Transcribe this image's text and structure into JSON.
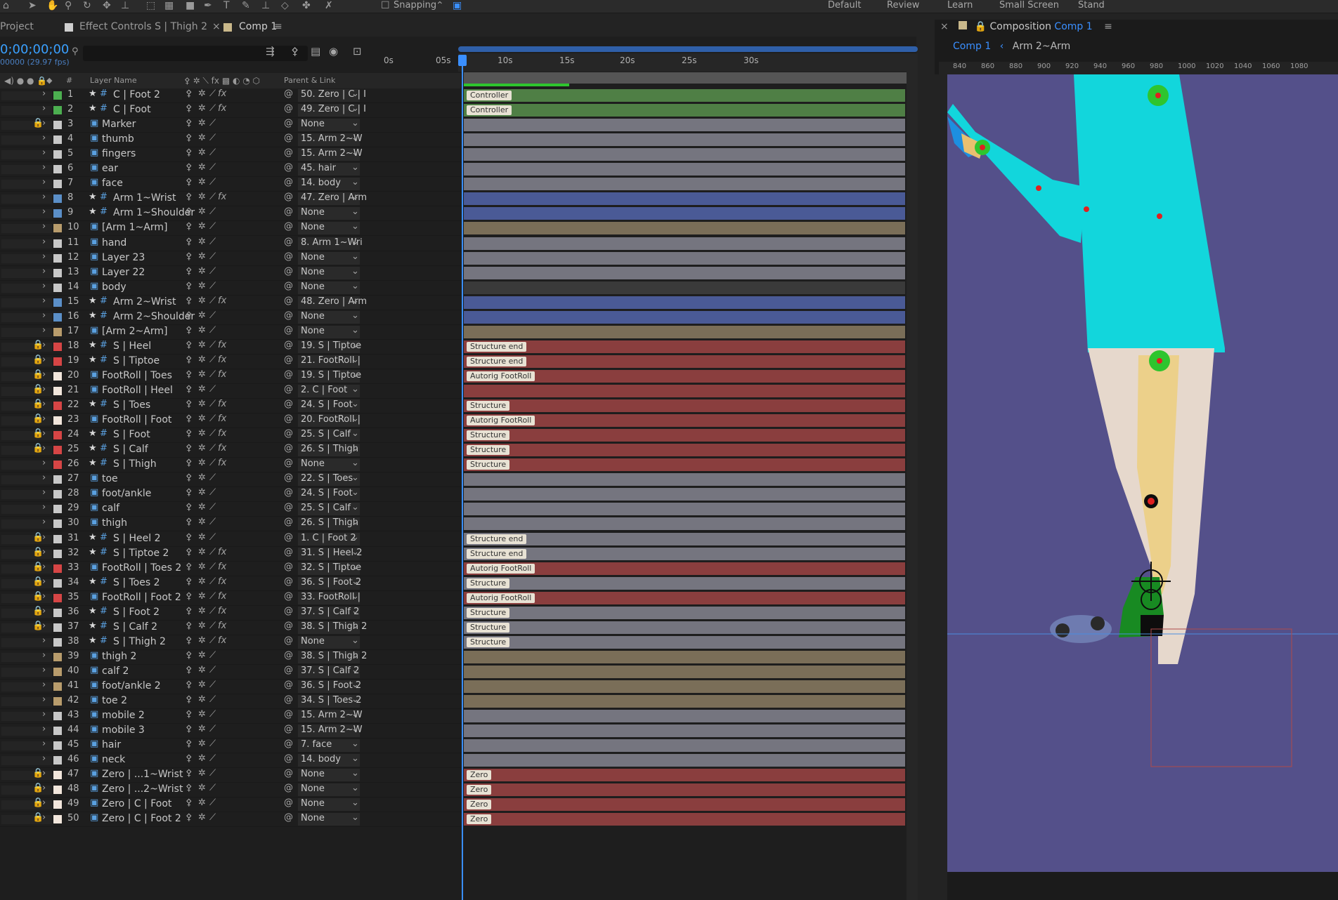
{
  "toolbar": {
    "snapping_label": "Snapping",
    "workspaces": [
      "Default",
      "Review",
      "Learn",
      "Small Screen",
      "Stand"
    ]
  },
  "tabs": {
    "project": "Project",
    "effect_controls": "Effect Controls S | Thigh 2",
    "comp": "Comp 1",
    "composition_prefix": "Composition",
    "composition_name": "Comp 1"
  },
  "timeline": {
    "timecode": "0;00;00;00",
    "fps": "00000 (29.97 fps)",
    "headers": {
      "hash": "#",
      "layer_name": "Layer Name",
      "parent": "Parent & Link"
    },
    "ticks": [
      "0s",
      "05s",
      "10s",
      "15s",
      "20s",
      "25s",
      "30s"
    ],
    "layers": [
      {
        "num": "1",
        "name": "C | Foot 2",
        "color": "#4caf50",
        "star": true,
        "locked": false,
        "fx": true,
        "parent": "50. Zero | C | I",
        "bar": "#4f7f45",
        "label": "Controller"
      },
      {
        "num": "2",
        "name": "C | Foot",
        "color": "#4caf50",
        "star": true,
        "locked": false,
        "fx": true,
        "parent": "49. Zero | C | I",
        "bar": "#4f7f45",
        "label": "Controller"
      },
      {
        "num": "3",
        "name": "Marker",
        "color": "#c8c8c8",
        "star": false,
        "locked": true,
        "fx": false,
        "parent": "None",
        "bar": "#75757f",
        "label": ""
      },
      {
        "num": "4",
        "name": "thumb",
        "color": "#c8c8c8",
        "star": false,
        "locked": false,
        "fx": false,
        "parent": "15. Arm 2~W",
        "bar": "#75757f",
        "label": ""
      },
      {
        "num": "5",
        "name": "fingers",
        "color": "#c8c8c8",
        "star": false,
        "locked": false,
        "fx": false,
        "parent": "15. Arm 2~W",
        "bar": "#75757f",
        "label": ""
      },
      {
        "num": "6",
        "name": "ear",
        "color": "#c8c8c8",
        "star": false,
        "locked": false,
        "fx": false,
        "parent": "45. hair",
        "bar": "#75757f",
        "label": ""
      },
      {
        "num": "7",
        "name": "face",
        "color": "#c8c8c8",
        "star": false,
        "locked": false,
        "fx": false,
        "parent": "14. body",
        "bar": "#75757f",
        "label": ""
      },
      {
        "num": "8",
        "name": "Arm 1~Wrist",
        "color": "#5b8fc8",
        "star": true,
        "locked": false,
        "fx": true,
        "parent": "47. Zero | Arm",
        "bar": "#4a5a96",
        "label": ""
      },
      {
        "num": "9",
        "name": "Arm 1~Shoulder",
        "color": "#5b8fc8",
        "star": true,
        "locked": false,
        "fx": false,
        "parent": "None",
        "bar": "#4a5a96",
        "label": ""
      },
      {
        "num": "10",
        "name": "[Arm 1~Arm]",
        "color": "#b89c6c",
        "star": false,
        "locked": false,
        "fx": false,
        "parent": "None",
        "bar": "#7a6e58",
        "label": ""
      },
      {
        "num": "11",
        "name": "hand",
        "color": "#c8c8c8",
        "star": false,
        "locked": false,
        "fx": false,
        "parent": "8. Arm 1~Wri",
        "bar": "#75757f",
        "label": ""
      },
      {
        "num": "12",
        "name": "Layer 23",
        "color": "#c8c8c8",
        "star": false,
        "locked": false,
        "fx": false,
        "parent": "None",
        "bar": "#75757f",
        "label": ""
      },
      {
        "num": "13",
        "name": "Layer 22",
        "color": "#c8c8c8",
        "star": false,
        "locked": false,
        "fx": false,
        "parent": "None",
        "bar": "#75757f",
        "label": ""
      },
      {
        "num": "14",
        "name": "body",
        "color": "#c8c8c8",
        "star": false,
        "locked": false,
        "fx": false,
        "parent": "None",
        "bar": "#3a3a3a",
        "label": ""
      },
      {
        "num": "15",
        "name": "Arm 2~Wrist",
        "color": "#5b8fc8",
        "star": true,
        "locked": false,
        "fx": true,
        "parent": "48. Zero | Arm",
        "bar": "#4a5a96",
        "label": ""
      },
      {
        "num": "16",
        "name": "Arm 2~Shoulder",
        "color": "#5b8fc8",
        "star": true,
        "locked": false,
        "fx": false,
        "parent": "None",
        "bar": "#4a5a96",
        "label": ""
      },
      {
        "num": "17",
        "name": "[Arm 2~Arm]",
        "color": "#b89c6c",
        "star": false,
        "locked": false,
        "fx": false,
        "parent": "None",
        "bar": "#7a6e58",
        "label": ""
      },
      {
        "num": "18",
        "name": "S | Heel",
        "color": "#d64545",
        "star": true,
        "locked": true,
        "fx": true,
        "parent": "19. S | Tiptoe",
        "bar": "#8a3e3e",
        "label": "Structure end"
      },
      {
        "num": "19",
        "name": "S | Tiptoe",
        "color": "#d64545",
        "star": true,
        "locked": true,
        "fx": true,
        "parent": "21. FootRoll |",
        "bar": "#8a3e3e",
        "label": "Structure end"
      },
      {
        "num": "20",
        "name": "FootRoll | Toes",
        "color": "#f2e6dc",
        "star": false,
        "locked": true,
        "fx": true,
        "parent": "19. S | Tiptoe",
        "bar": "#8a3e3e",
        "label": "Autorig FootRoll"
      },
      {
        "num": "21",
        "name": "FootRoll | Heel",
        "color": "#f2e6dc",
        "star": false,
        "locked": true,
        "fx": false,
        "parent": "2. C | Foot",
        "bar": "#8a3e3e",
        "label": ""
      },
      {
        "num": "22",
        "name": "S | Toes",
        "color": "#d64545",
        "star": true,
        "locked": true,
        "fx": true,
        "parent": "24. S | Foot",
        "bar": "#8a3e3e",
        "label": "Structure"
      },
      {
        "num": "23",
        "name": "FootRoll | Foot",
        "color": "#f2e6dc",
        "star": false,
        "locked": true,
        "fx": true,
        "parent": "20. FootRoll |",
        "bar": "#8a3e3e",
        "label": "Autorig FootRoll"
      },
      {
        "num": "24",
        "name": "S | Foot",
        "color": "#d64545",
        "star": true,
        "locked": true,
        "fx": true,
        "parent": "25. S | Calf",
        "bar": "#8a3e3e",
        "label": "Structure"
      },
      {
        "num": "25",
        "name": "S | Calf",
        "color": "#d64545",
        "star": true,
        "locked": true,
        "fx": true,
        "parent": "26. S | Thigh",
        "bar": "#8a3e3e",
        "label": "Structure"
      },
      {
        "num": "26",
        "name": "S | Thigh",
        "color": "#d64545",
        "star": true,
        "locked": false,
        "fx": true,
        "parent": "None",
        "bar": "#8a3e3e",
        "label": "Structure"
      },
      {
        "num": "27",
        "name": "toe",
        "color": "#c8c8c8",
        "star": false,
        "locked": false,
        "fx": false,
        "parent": "22. S | Toes",
        "bar": "#75757f",
        "label": ""
      },
      {
        "num": "28",
        "name": "foot/ankle",
        "color": "#c8c8c8",
        "star": false,
        "locked": false,
        "fx": false,
        "parent": "24. S | Foot",
        "bar": "#75757f",
        "label": ""
      },
      {
        "num": "29",
        "name": "calf",
        "color": "#c8c8c8",
        "star": false,
        "locked": false,
        "fx": false,
        "parent": "25. S | Calf",
        "bar": "#75757f",
        "label": ""
      },
      {
        "num": "30",
        "name": "thigh",
        "color": "#c8c8c8",
        "star": false,
        "locked": false,
        "fx": false,
        "parent": "26. S | Thigh",
        "bar": "#75757f",
        "label": ""
      },
      {
        "num": "31",
        "name": "S | Heel 2",
        "color": "#c8c8c8",
        "star": true,
        "locked": true,
        "fx": false,
        "parent": "1. C | Foot 2",
        "bar": "#75757f",
        "label": "Structure end"
      },
      {
        "num": "32",
        "name": "S | Tiptoe 2",
        "color": "#c8c8c8",
        "star": true,
        "locked": true,
        "fx": true,
        "parent": "31. S | Heel 2",
        "bar": "#75757f",
        "label": "Structure end"
      },
      {
        "num": "33",
        "name": "FootRoll | Toes 2",
        "color": "#d64545",
        "star": false,
        "locked": true,
        "fx": true,
        "parent": "32. S | Tiptoe",
        "bar": "#8a3e3e",
        "label": "Autorig FootRoll"
      },
      {
        "num": "34",
        "name": "S | Toes 2",
        "color": "#c8c8c8",
        "star": true,
        "locked": true,
        "fx": true,
        "parent": "36. S | Foot 2",
        "bar": "#75757f",
        "label": "Structure"
      },
      {
        "num": "35",
        "name": "FootRoll | Foot 2",
        "color": "#d64545",
        "star": false,
        "locked": true,
        "fx": true,
        "parent": "33. FootRoll |",
        "bar": "#8a3e3e",
        "label": "Autorig FootRoll"
      },
      {
        "num": "36",
        "name": "S | Foot 2",
        "color": "#c8c8c8",
        "star": true,
        "locked": true,
        "fx": true,
        "parent": "37. S | Calf 2",
        "bar": "#75757f",
        "label": "Structure"
      },
      {
        "num": "37",
        "name": "S | Calf 2",
        "color": "#c8c8c8",
        "star": true,
        "locked": true,
        "fx": true,
        "parent": "38. S | Thigh 2",
        "bar": "#75757f",
        "label": "Structure"
      },
      {
        "num": "38",
        "name": "S | Thigh 2",
        "color": "#c8c8c8",
        "star": true,
        "locked": false,
        "fx": true,
        "parent": "None",
        "bar": "#75757f",
        "label": "Structure"
      },
      {
        "num": "39",
        "name": "thigh 2",
        "color": "#b89c6c",
        "star": false,
        "locked": false,
        "fx": false,
        "parent": "38. S | Thigh 2",
        "bar": "#7a6e58",
        "label": ""
      },
      {
        "num": "40",
        "name": "calf 2",
        "color": "#b89c6c",
        "star": false,
        "locked": false,
        "fx": false,
        "parent": "37. S | Calf 2",
        "bar": "#7a6e58",
        "label": ""
      },
      {
        "num": "41",
        "name": "foot/ankle 2",
        "color": "#b89c6c",
        "star": false,
        "locked": false,
        "fx": false,
        "parent": "36. S | Foot 2",
        "bar": "#7a6e58",
        "label": ""
      },
      {
        "num": "42",
        "name": "toe 2",
        "color": "#b89c6c",
        "star": false,
        "locked": false,
        "fx": false,
        "parent": "34. S | Toes 2",
        "bar": "#7a6e58",
        "label": ""
      },
      {
        "num": "43",
        "name": "mobile 2",
        "color": "#c8c8c8",
        "star": false,
        "locked": false,
        "fx": false,
        "parent": "15. Arm 2~W",
        "bar": "#75757f",
        "label": ""
      },
      {
        "num": "44",
        "name": "mobile 3",
        "color": "#c8c8c8",
        "star": false,
        "locked": false,
        "fx": false,
        "parent": "15. Arm 2~W",
        "bar": "#75757f",
        "label": ""
      },
      {
        "num": "45",
        "name": "hair",
        "color": "#c8c8c8",
        "star": false,
        "locked": false,
        "fx": false,
        "parent": "7. face",
        "bar": "#75757f",
        "label": ""
      },
      {
        "num": "46",
        "name": "neck",
        "color": "#c8c8c8",
        "star": false,
        "locked": false,
        "fx": false,
        "parent": "14. body",
        "bar": "#75757f",
        "label": ""
      },
      {
        "num": "47",
        "name": "Zero | ...1~Wrist",
        "color": "#f2e6dc",
        "star": false,
        "locked": true,
        "fx": false,
        "parent": "None",
        "bar": "#8a3e3e",
        "label": "Zero"
      },
      {
        "num": "48",
        "name": "Zero | ...2~Wrist",
        "color": "#f2e6dc",
        "star": false,
        "locked": true,
        "fx": false,
        "parent": "None",
        "bar": "#8a3e3e",
        "label": "Zero"
      },
      {
        "num": "49",
        "name": "Zero | C | Foot",
        "color": "#f2e6dc",
        "star": false,
        "locked": true,
        "fx": false,
        "parent": "None",
        "bar": "#8a3e3e",
        "label": "Zero"
      },
      {
        "num": "50",
        "name": "Zero | C | Foot 2",
        "color": "#f2e6dc",
        "star": false,
        "locked": true,
        "fx": false,
        "parent": "None",
        "bar": "#8a3e3e",
        "label": "Zero"
      }
    ]
  },
  "viewer": {
    "breadcrumb_comp": "Comp 1",
    "breadcrumb_sub": "Arm 2~Arm",
    "ruler_ticks": [
      "840",
      "860",
      "880",
      "900",
      "920",
      "940",
      "960",
      "980",
      "1000",
      "1020",
      "1040",
      "1060",
      "1080"
    ],
    "colors": {
      "background": "#54508a",
      "shirt": "#12d6dc",
      "skin": "#e6d8cc",
      "leg_bone": "#ecd08a",
      "controller": "#2ec52e"
    }
  }
}
